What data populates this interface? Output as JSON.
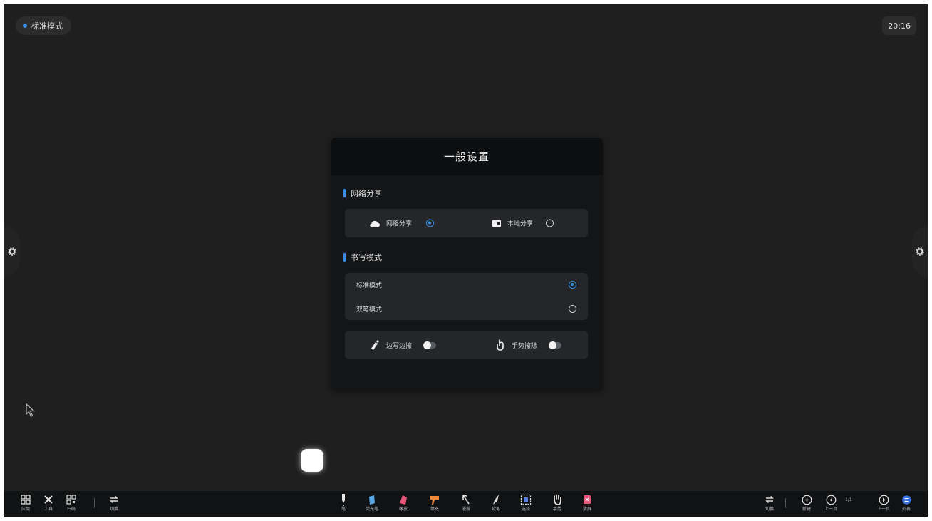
{
  "status": {
    "mode": "标准模式",
    "time": "20:16"
  },
  "dialog": {
    "title": "一般设置",
    "network_section": "网络分享",
    "share_options": [
      {
        "label": "网络分享",
        "selected": true
      },
      {
        "label": "本地分享",
        "selected": false
      }
    ],
    "writing_section": "书写模式",
    "writing_modes": [
      {
        "label": "标准模式",
        "selected": true
      },
      {
        "label": "双笔模式",
        "selected": false
      }
    ],
    "toggles": [
      {
        "label": "边写边擦",
        "on": false
      },
      {
        "label": "手势擦除",
        "on": false
      }
    ]
  },
  "toolbar": {
    "left": [
      {
        "icon": "apps-icon",
        "label": "应用"
      },
      {
        "icon": "tools-icon",
        "label": "工具"
      },
      {
        "icon": "qr-icon",
        "label": "扫码"
      },
      {
        "icon": "switch-icon",
        "label": "切换"
      }
    ],
    "center": [
      {
        "icon": "pen-icon",
        "label": "笔"
      },
      {
        "icon": "highlighter-icon",
        "label": "荧光笔"
      },
      {
        "icon": "eraser-icon",
        "label": "橡皮"
      },
      {
        "icon": "fill-icon",
        "label": "填充"
      },
      {
        "icon": "pointer-icon",
        "label": "漫游"
      },
      {
        "icon": "brush-icon",
        "label": "软笔"
      },
      {
        "icon": "select-icon",
        "label": "选择"
      },
      {
        "icon": "hand-icon",
        "label": "手势"
      },
      {
        "icon": "clear-icon",
        "label": "清屏"
      }
    ],
    "right": [
      {
        "icon": "switch-icon",
        "label": "切换"
      },
      {
        "icon": "add-page-icon",
        "label": "新建"
      },
      {
        "icon": "prev-page-icon",
        "label": "上一页"
      },
      {
        "icon": "next-page-icon",
        "label": "下一页"
      },
      {
        "icon": "menu-icon",
        "label": "列表"
      }
    ],
    "page_indicator": "1/1"
  },
  "colors": {
    "accent": "#3a8ee6",
    "background": "#1f1f1f",
    "dialog": "#141517",
    "card": "#24262a"
  }
}
